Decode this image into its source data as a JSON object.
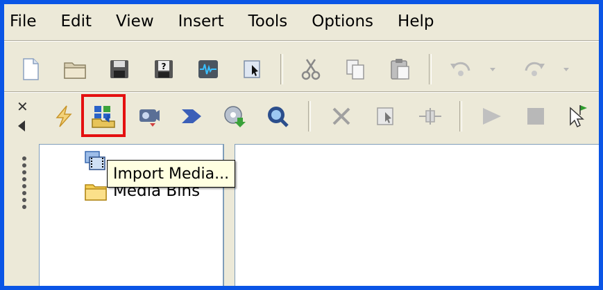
{
  "menu": {
    "file": "File",
    "edit": "Edit",
    "view": "View",
    "insert": "Insert",
    "tools": "Tools",
    "options": "Options",
    "help": "Help"
  },
  "toolbar1": [
    "new-file-icon",
    "open-folder-icon",
    "save-icon",
    "save-as-icon",
    "record-audio-icon",
    "select-icon",
    "cut-icon",
    "copy-icon",
    "paste-icon",
    "undo-icon",
    "redo-icon"
  ],
  "toolbar2": [
    "close-icon",
    "collapse-arrow-icon",
    "produce-lightning-icon",
    "import-media-icon",
    "capture-icon",
    "convert-icon",
    "publish-icon",
    "search-media-icon",
    "delete-icon",
    "select-icon",
    "split-icon",
    "play-icon",
    "stop-icon",
    "pointer-icon"
  ],
  "tooltip": {
    "text": "Import Media..."
  },
  "tree": {
    "media_bins": "Media Bins"
  },
  "colors": {
    "frame_border": "#0a55e6",
    "highlight": "#e41010",
    "tooltip_bg": "#ffffe1",
    "toolbar_bg": "#ece9d8"
  }
}
